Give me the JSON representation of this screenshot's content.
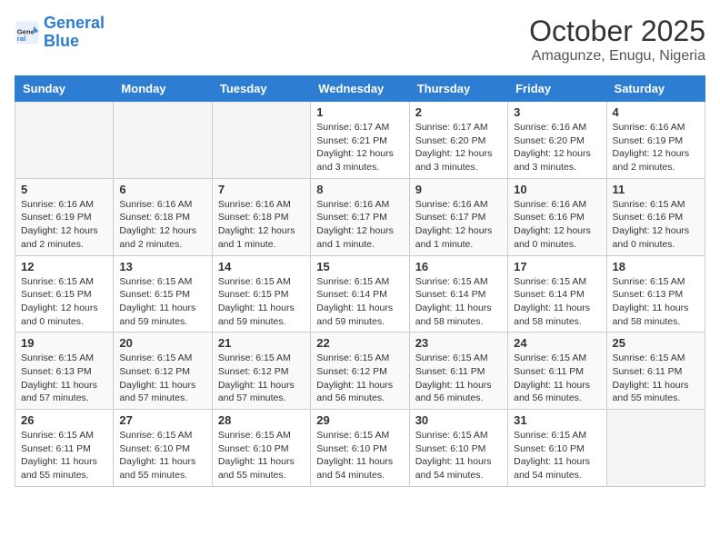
{
  "logo": {
    "line1": "General",
    "line2": "Blue"
  },
  "title": "October 2025",
  "location": "Amagunze, Enugu, Nigeria",
  "weekdays": [
    "Sunday",
    "Monday",
    "Tuesday",
    "Wednesday",
    "Thursday",
    "Friday",
    "Saturday"
  ],
  "weeks": [
    [
      {
        "day": null
      },
      {
        "day": null
      },
      {
        "day": null
      },
      {
        "day": 1,
        "sunrise": "6:17 AM",
        "sunset": "6:21 PM",
        "daylight": "12 hours and 3 minutes."
      },
      {
        "day": 2,
        "sunrise": "6:17 AM",
        "sunset": "6:20 PM",
        "daylight": "12 hours and 3 minutes."
      },
      {
        "day": 3,
        "sunrise": "6:16 AM",
        "sunset": "6:20 PM",
        "daylight": "12 hours and 3 minutes."
      },
      {
        "day": 4,
        "sunrise": "6:16 AM",
        "sunset": "6:19 PM",
        "daylight": "12 hours and 2 minutes."
      }
    ],
    [
      {
        "day": 5,
        "sunrise": "6:16 AM",
        "sunset": "6:19 PM",
        "daylight": "12 hours and 2 minutes."
      },
      {
        "day": 6,
        "sunrise": "6:16 AM",
        "sunset": "6:18 PM",
        "daylight": "12 hours and 2 minutes."
      },
      {
        "day": 7,
        "sunrise": "6:16 AM",
        "sunset": "6:18 PM",
        "daylight": "12 hours and 1 minute."
      },
      {
        "day": 8,
        "sunrise": "6:16 AM",
        "sunset": "6:17 PM",
        "daylight": "12 hours and 1 minute."
      },
      {
        "day": 9,
        "sunrise": "6:16 AM",
        "sunset": "6:17 PM",
        "daylight": "12 hours and 1 minute."
      },
      {
        "day": 10,
        "sunrise": "6:16 AM",
        "sunset": "6:16 PM",
        "daylight": "12 hours and 0 minutes."
      },
      {
        "day": 11,
        "sunrise": "6:15 AM",
        "sunset": "6:16 PM",
        "daylight": "12 hours and 0 minutes."
      }
    ],
    [
      {
        "day": 12,
        "sunrise": "6:15 AM",
        "sunset": "6:15 PM",
        "daylight": "12 hours and 0 minutes."
      },
      {
        "day": 13,
        "sunrise": "6:15 AM",
        "sunset": "6:15 PM",
        "daylight": "11 hours and 59 minutes."
      },
      {
        "day": 14,
        "sunrise": "6:15 AM",
        "sunset": "6:15 PM",
        "daylight": "11 hours and 59 minutes."
      },
      {
        "day": 15,
        "sunrise": "6:15 AM",
        "sunset": "6:14 PM",
        "daylight": "11 hours and 59 minutes."
      },
      {
        "day": 16,
        "sunrise": "6:15 AM",
        "sunset": "6:14 PM",
        "daylight": "11 hours and 58 minutes."
      },
      {
        "day": 17,
        "sunrise": "6:15 AM",
        "sunset": "6:14 PM",
        "daylight": "11 hours and 58 minutes."
      },
      {
        "day": 18,
        "sunrise": "6:15 AM",
        "sunset": "6:13 PM",
        "daylight": "11 hours and 58 minutes."
      }
    ],
    [
      {
        "day": 19,
        "sunrise": "6:15 AM",
        "sunset": "6:13 PM",
        "daylight": "11 hours and 57 minutes."
      },
      {
        "day": 20,
        "sunrise": "6:15 AM",
        "sunset": "6:12 PM",
        "daylight": "11 hours and 57 minutes."
      },
      {
        "day": 21,
        "sunrise": "6:15 AM",
        "sunset": "6:12 PM",
        "daylight": "11 hours and 57 minutes."
      },
      {
        "day": 22,
        "sunrise": "6:15 AM",
        "sunset": "6:12 PM",
        "daylight": "11 hours and 56 minutes."
      },
      {
        "day": 23,
        "sunrise": "6:15 AM",
        "sunset": "6:11 PM",
        "daylight": "11 hours and 56 minutes."
      },
      {
        "day": 24,
        "sunrise": "6:15 AM",
        "sunset": "6:11 PM",
        "daylight": "11 hours and 56 minutes."
      },
      {
        "day": 25,
        "sunrise": "6:15 AM",
        "sunset": "6:11 PM",
        "daylight": "11 hours and 55 minutes."
      }
    ],
    [
      {
        "day": 26,
        "sunrise": "6:15 AM",
        "sunset": "6:11 PM",
        "daylight": "11 hours and 55 minutes."
      },
      {
        "day": 27,
        "sunrise": "6:15 AM",
        "sunset": "6:10 PM",
        "daylight": "11 hours and 55 minutes."
      },
      {
        "day": 28,
        "sunrise": "6:15 AM",
        "sunset": "6:10 PM",
        "daylight": "11 hours and 55 minutes."
      },
      {
        "day": 29,
        "sunrise": "6:15 AM",
        "sunset": "6:10 PM",
        "daylight": "11 hours and 54 minutes."
      },
      {
        "day": 30,
        "sunrise": "6:15 AM",
        "sunset": "6:10 PM",
        "daylight": "11 hours and 54 minutes."
      },
      {
        "day": 31,
        "sunrise": "6:15 AM",
        "sunset": "6:10 PM",
        "daylight": "11 hours and 54 minutes."
      },
      {
        "day": null
      }
    ]
  ]
}
